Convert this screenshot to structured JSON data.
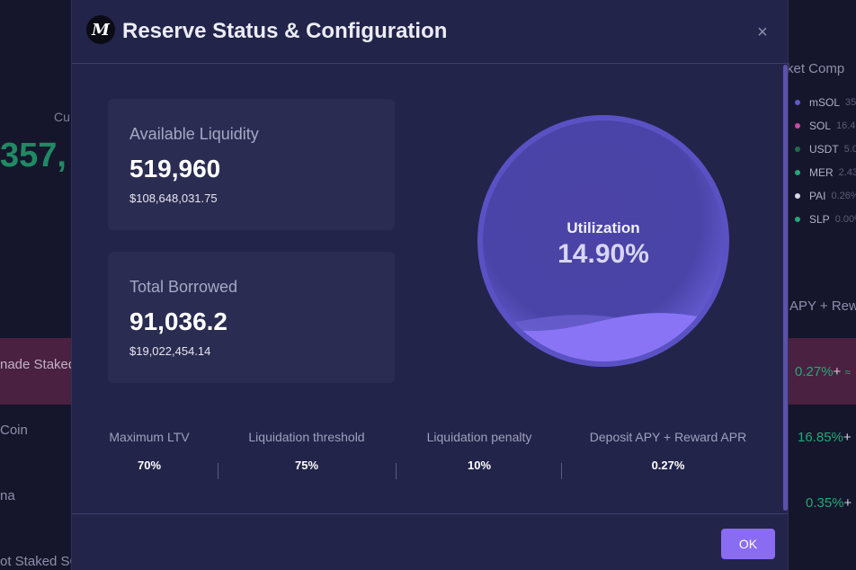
{
  "background": {
    "current_label": "Cu",
    "big_value": "357,",
    "right_title": "rket Comp",
    "legend": [
      {
        "name": "mSOL",
        "value": "35",
        "color": "#5f59c9"
      },
      {
        "name": "SOL",
        "value": "16.4",
        "color": "#c94aa6"
      },
      {
        "name": "USDT",
        "value": "5.0",
        "color": "#1f6b4a"
      },
      {
        "name": "MER",
        "value": "2.43",
        "color": "#25a77a"
      },
      {
        "name": "PAI",
        "value": "0.26%",
        "color": "#d9d9e6"
      },
      {
        "name": "SLP",
        "value": "0.00%",
        "color": "#25a77a"
      }
    ],
    "apy_header": "APY + Rew",
    "rows": [
      {
        "name": "nade Staked",
        "apy": "0.27%",
        "plus": "+",
        "extra": "≈"
      },
      {
        "name": "Coin",
        "apy": "16.85%",
        "plus": "+"
      },
      {
        "name": "na",
        "apy": "0.35%",
        "plus": "+"
      },
      {
        "name": "ot Staked SC"
      }
    ]
  },
  "modal": {
    "logo_letter": "M",
    "title": "Reserve Status & Configuration",
    "close_symbol": "×",
    "available_liquidity": {
      "label": "Available Liquidity",
      "value": "519,960",
      "usd": "$108,648,031.75"
    },
    "total_borrowed": {
      "label": "Total Borrowed",
      "value": "91,036.2",
      "usd": "$19,022,454.14"
    },
    "utilization": {
      "label": "Utilization",
      "value": "14.90%",
      "fraction": 0.149
    },
    "params": [
      {
        "label": "Maximum LTV",
        "value": "70%"
      },
      {
        "label": "Liquidation threshold",
        "value": "75%"
      },
      {
        "label": "Liquidation penalty",
        "value": "10%"
      },
      {
        "label": "Deposit APY + Reward APR",
        "value": "0.27%"
      }
    ],
    "ok_label": "OK"
  },
  "colors": {
    "accent": "#8a6cf2",
    "positive": "#22a87a",
    "modal_bg": "#23244a"
  }
}
